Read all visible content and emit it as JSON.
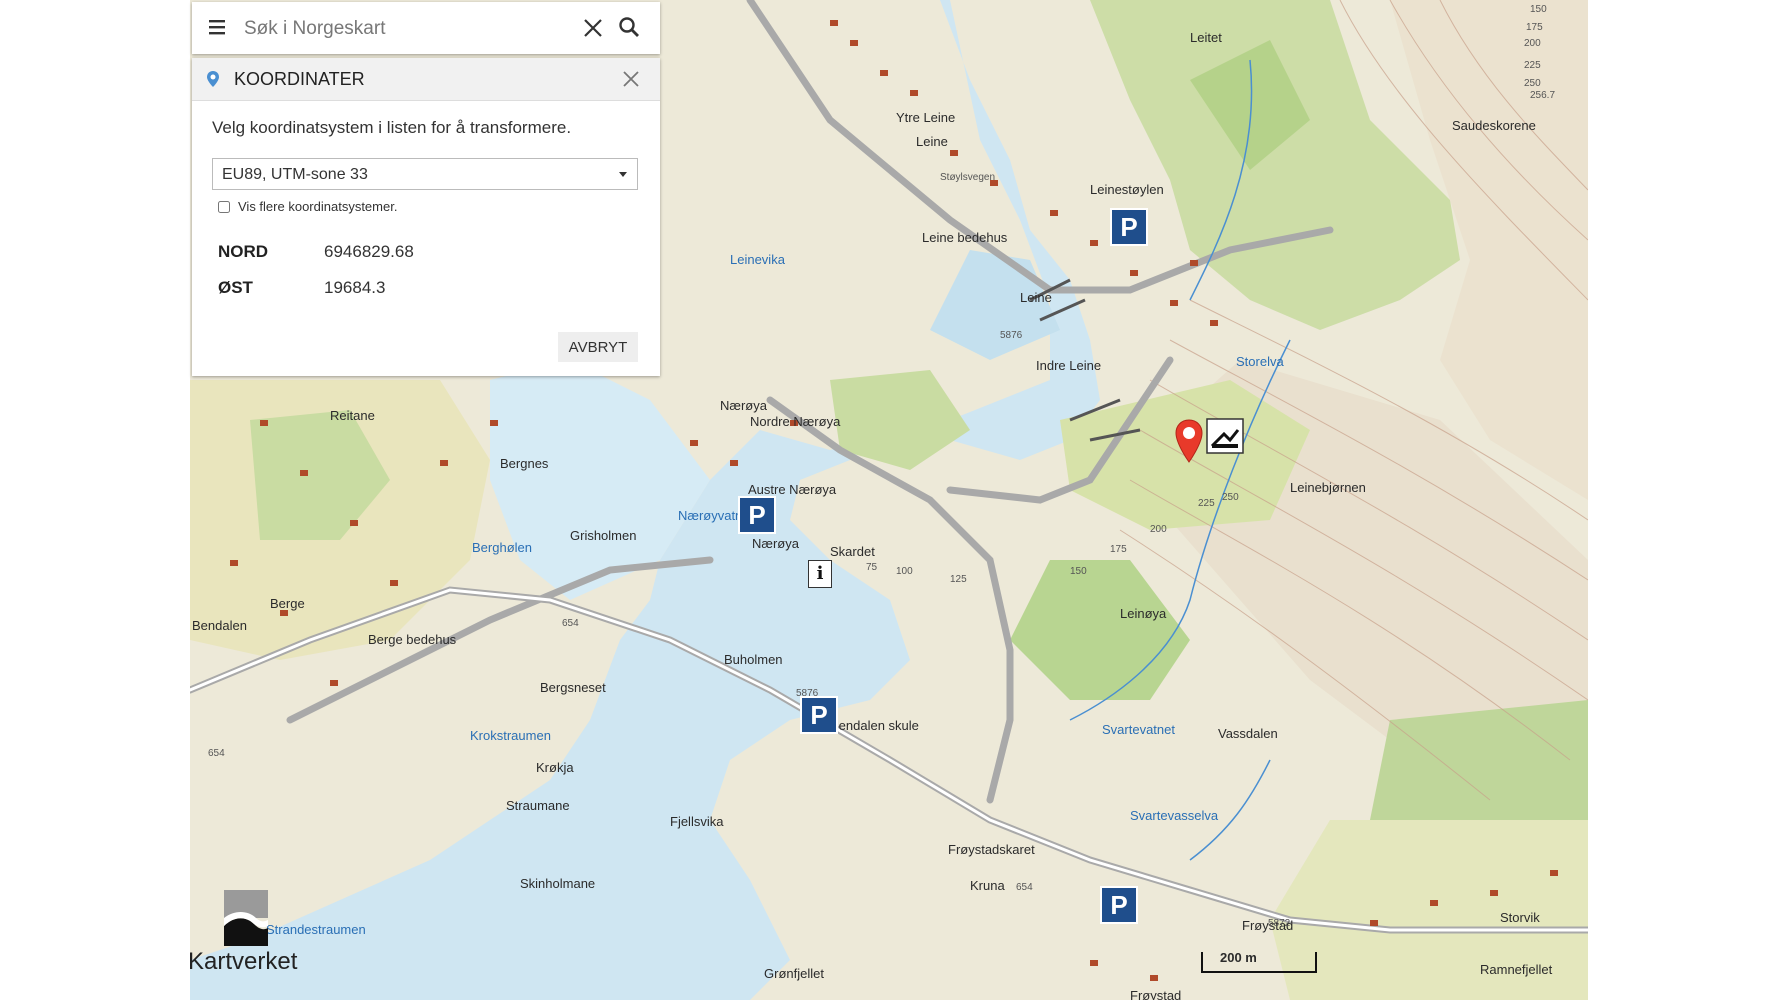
{
  "search": {
    "placeholder": "Søk i Norgeskart"
  },
  "panel": {
    "title": "KOORDINATER",
    "description": "Velg koordinatsystem i listen for å transformere.",
    "selected_system": "EU89, UTM-sone 33",
    "checkbox_label": "Vis flere koordinatsystemer.",
    "coords": [
      {
        "label": "NORD",
        "value": "6946829.68"
      },
      {
        "label": "ØST",
        "value": "19684.3"
      }
    ],
    "cancel_label": "AVBRYT"
  },
  "map": {
    "place_labels": [
      "Leitet",
      "Saudeskorene",
      "Ytre Leine",
      "Leine",
      "Støylsvegen",
      "Leinestøylen",
      "Leine bedehus",
      "Leinevika",
      "Leine",
      "Indre Leine",
      "Storelva",
      "Reitane",
      "Nærøya",
      "Nordre Nærøya",
      "Bergnes",
      "Austre Nærøya",
      "Leinebjørnen",
      "Nærøyvatnet",
      "Grisholmen",
      "Nærøya",
      "Skardet",
      "Berghølen",
      "Berge",
      "Bendalen",
      "Berge bedehus",
      "Buholmen",
      "Leinøya",
      "Bergsneset",
      "Krokstraumen",
      "Bendalen skule",
      "Svartevatnet",
      "Vassdalen",
      "Krøkja",
      "Straumane",
      "Fjellsvika",
      "Svartevasselva",
      "Frøystadskaret",
      "Kruna",
      "Skinholmane",
      "Strandestraumen",
      "Frøystad",
      "Storvik",
      "Grønfjellet",
      "Ramnefjellet",
      "Frøystad"
    ],
    "road_numbers": [
      "5876",
      "654",
      "5876",
      "654",
      "5872",
      "654"
    ],
    "contour_labels": [
      "150",
      "175",
      "200",
      "225",
      "250",
      "256.7",
      "225",
      "250",
      "200",
      "175",
      "150",
      "125",
      "100",
      "75"
    ],
    "logo": "Kartverket",
    "scale": "200 m",
    "symbols": [
      "parking-sign",
      "parking-sign",
      "parking-sign",
      "parking-sign",
      "info-sign",
      "viewpoint-sign",
      "location-pin"
    ]
  }
}
